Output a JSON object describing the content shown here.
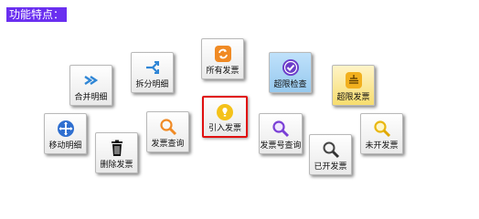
{
  "title": "功能特点：",
  "buttons": {
    "merge": "合并明细",
    "split": "拆分明细",
    "all_invoices": "所有发票",
    "over_limit_check": "超限检查",
    "over_limit_invoice": "超限发票",
    "move_detail": "移动明细",
    "delete_invoice": "删除发票",
    "invoice_query": "发票查询",
    "import_invoice": "引入发票",
    "invoice_no_query": "发票号查询",
    "issued_invoice": "已开发票",
    "not_issued_invoice": "未开发票"
  },
  "colors": {
    "title_bg": "#6a2ff0",
    "selected_border": "#e01010",
    "accent_orange": "#f08a24",
    "accent_blue": "#2f86d6",
    "accent_purple": "#6b3cc9"
  }
}
